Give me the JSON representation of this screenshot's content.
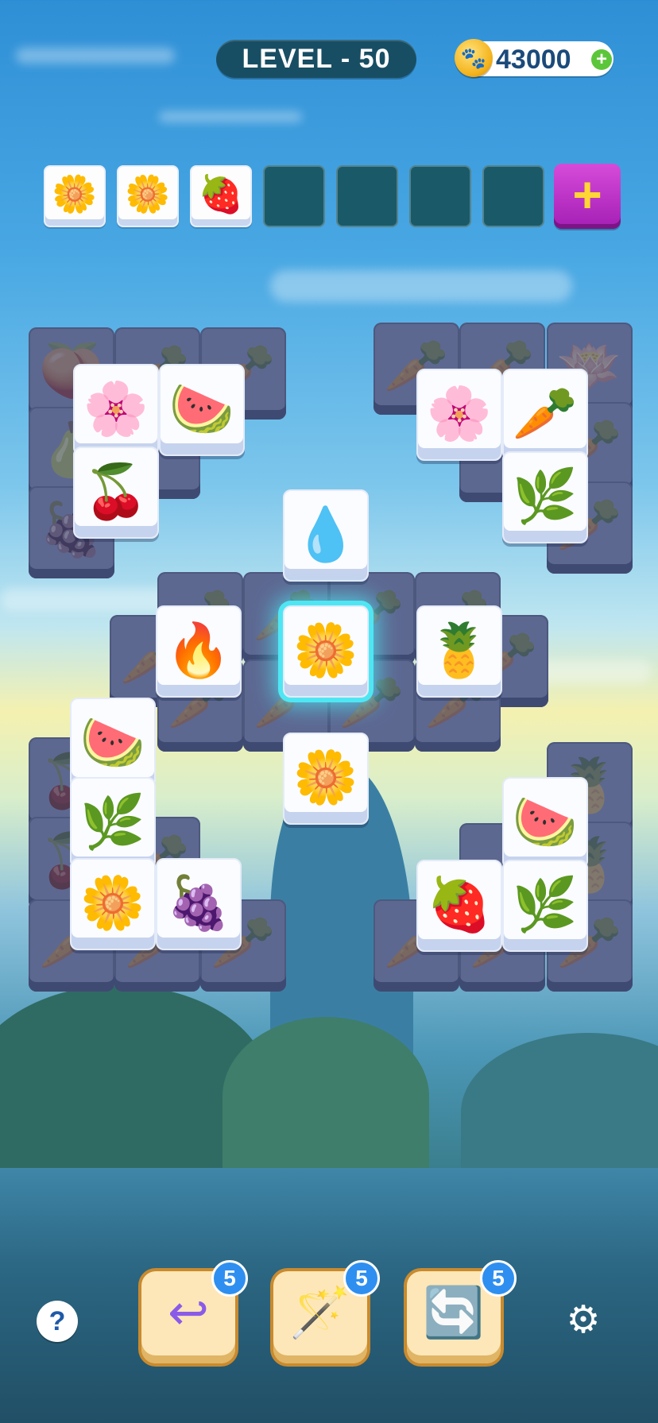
{
  "header": {
    "level_text": "LEVEL - 50",
    "coins": "43000",
    "coin_icon": "paw-coin-icon",
    "coin_add_icon": "plus-icon"
  },
  "tray": {
    "slots": [
      {
        "icon": "flower-icon",
        "glyph": "🌼"
      },
      {
        "icon": "flower-icon",
        "glyph": "🌼"
      },
      {
        "icon": "strawberry-icon",
        "glyph": "🍓"
      },
      {
        "icon": "",
        "glyph": ""
      },
      {
        "icon": "",
        "glyph": ""
      },
      {
        "icon": "",
        "glyph": ""
      },
      {
        "icon": "",
        "glyph": ""
      }
    ],
    "add_label": "+"
  },
  "tiles": {
    "back_glyphs": {
      "carrot": "🥕",
      "plum": "🍑",
      "grapes": "🍇",
      "pear": "🍐",
      "cherry": "🍒",
      "pineapple": "🍍",
      "lotus": "🪷"
    },
    "front": {
      "plumeria": "🌸",
      "watermelon": "🍉",
      "cherry": "🍒",
      "water": "💧",
      "fire": "🔥",
      "flower": "🌼",
      "pineapple": "🍍",
      "leaf": "🌿",
      "grapes": "🍇",
      "strawberry": "🍓",
      "carrot": "🥕"
    }
  },
  "boosters": {
    "undo": {
      "icon": "undo-arrow-icon",
      "glyph": "↩",
      "count": "5"
    },
    "wand": {
      "icon": "magic-wand-icon",
      "glyph": "🪄",
      "count": "5"
    },
    "shuffle": {
      "icon": "shuffle-icon",
      "glyph": "🔄",
      "count": "5"
    }
  },
  "help_label": "?",
  "settings_glyph": "⚙"
}
